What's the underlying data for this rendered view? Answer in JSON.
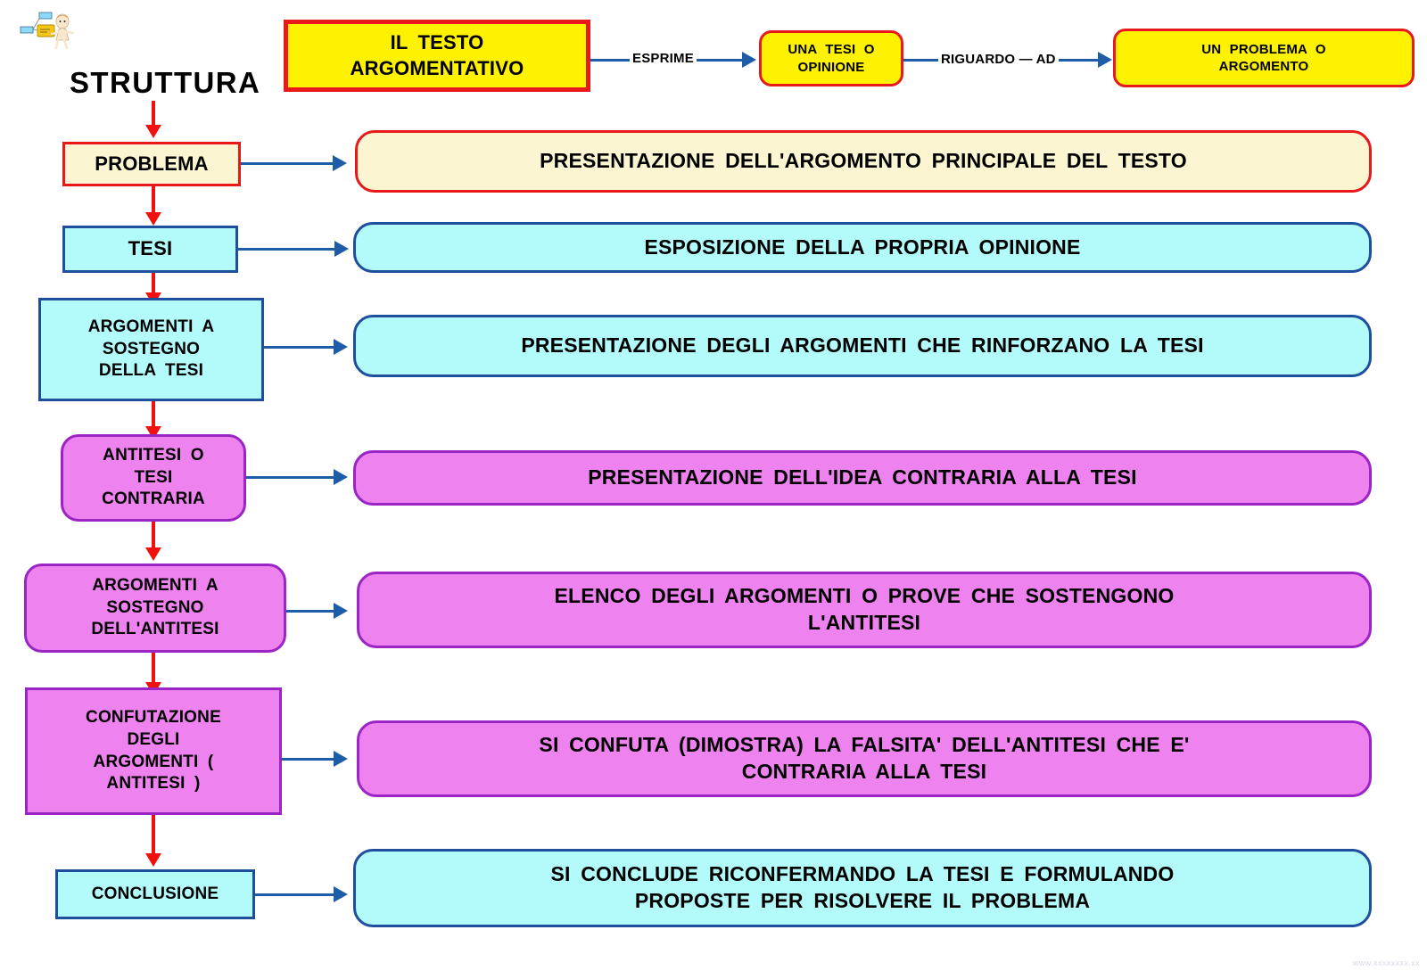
{
  "title": "STRUTTURA",
  "top_chain": {
    "source": {
      "label": "IL    TESTO\nARGOMENTATIVO"
    },
    "edge1": {
      "label": "ESPRIME"
    },
    "node1": {
      "label": "UNA   TESI   O\nOPINIONE"
    },
    "edge2": {
      "label": "RIGUARDO — AD"
    },
    "node2": {
      "label": "UN    PROBLEMA    O\nARGOMENTO"
    }
  },
  "steps": [
    {
      "name": "problema",
      "label": "PROBLEMA",
      "description": "PRESENTAZIONE      DELL'ARGOMENTO      PRINCIPALE    DEL    TESTO",
      "fill": "#FCF5D2",
      "border": "#E8191B"
    },
    {
      "name": "tesi",
      "label": "TESI",
      "description": "ESPOSIZIONE    DELLA    PROPRIA    OPINIONE",
      "fill": "#B3FAFA",
      "border": "#1F4E9C"
    },
    {
      "name": "argomenti-a-sostegno-della-tesi",
      "label": "ARGOMENTI    A\nSOSTEGNO\nDELLA    TESI",
      "description": "PRESENTAZIONE     DEGLI     ARGOMENTI    CHE    RINFORZANO    LA   TESI",
      "fill": "#B3FAFA",
      "border": "#1F4E9C"
    },
    {
      "name": "antitesi-o-tesi-contraria",
      "label": "ANTITESI    O\nTESI\nCONTRARIA",
      "description": "PRESENTAZIONE     DELL'IDEA     CONTRARIA     ALLA    TESI",
      "fill": "#EE82EE",
      "border": "#9A25C4"
    },
    {
      "name": "argomenti-a-sostegno-dellantitesi",
      "label": "ARGOMENTI    A\nSOSTEGNO\nDELL'ANTITESI",
      "description": "ELENCO     DEGLI     ARGOMENTI    O    PROVE    CHE     SOSTENGONO\nL'ANTITESI",
      "fill": "#EE82EE",
      "border": "#9A25C4"
    },
    {
      "name": "confutazione-degli-argomenti",
      "label": "CONFUTAZIONE\nDEGLI\nARGOMENTI    (\nANTITESI   )",
      "description": "SI     CONFUTA     (DIMOSTRA)    LA    FALSITA'    DELL'ANTITESI     CHE   E'\nCONTRARIA     ALLA    TESI",
      "fill": "#EE82EE",
      "border": "#9A25C4"
    },
    {
      "name": "conclusione",
      "label": "CONCLUSIONE",
      "description": "SI    CONCLUDE     RICONFERMANDO    LA   TESI  E    FORMULANDO\nPROPOSTE    PER    RISOLVERE   IL    PROBLEMA",
      "fill": "#B3FAFA",
      "border": "#1F4E9C"
    }
  ],
  "icons": {
    "clipart": "person-with-diagram-icon",
    "down_arrow": "down-arrow-icon",
    "right_arrow": "right-arrow-icon"
  },
  "watermark": "www.xxxxxxxx.xx"
}
